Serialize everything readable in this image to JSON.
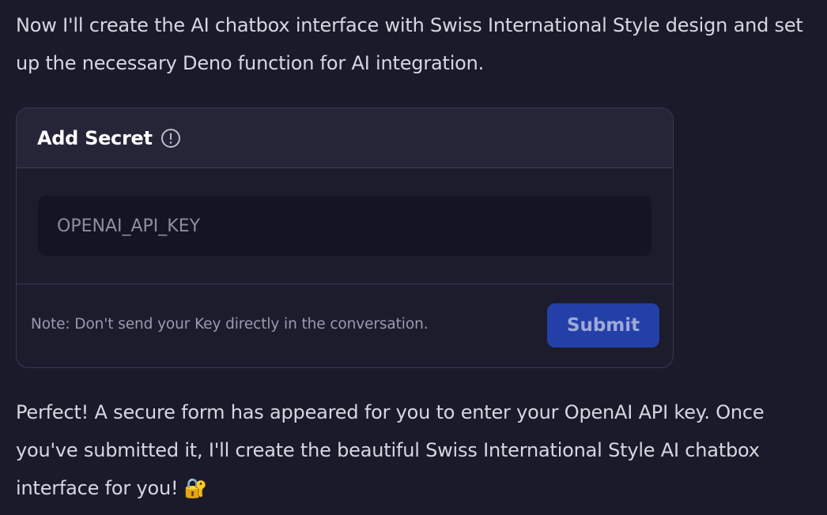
{
  "messages": {
    "intro": "Now I'll create the AI chatbox interface with Swiss International Style design and set up the necessary Deno function for AI integration.",
    "followup": "Perfect! A secure form has appeared for you to enter your OpenAI API key. Once you've submitted it, I'll create the beautiful Swiss International Style AI chatbox interface for you! 🔐"
  },
  "secret_form": {
    "title": "Add Secret",
    "info_icon": "info-circle-icon",
    "input": {
      "value": "",
      "placeholder": "OPENAI_API_KEY"
    },
    "note": "Note: Don't send your Key directly in the conversation.",
    "submit_label": "Submit"
  },
  "colors": {
    "background": "#1b1a2b",
    "card_header": "#262538",
    "input_bg": "#151423",
    "submit_bg": "#2340a8",
    "text": "#d7d7e0"
  }
}
